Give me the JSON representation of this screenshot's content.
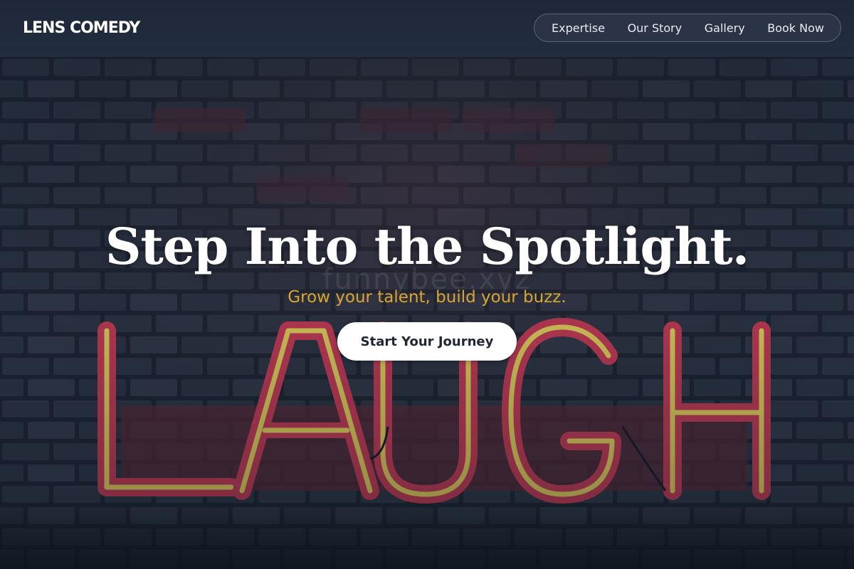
{
  "header": {
    "logo": "LENS COMEDY",
    "nav": [
      {
        "label": "Expertise"
      },
      {
        "label": "Our Story"
      },
      {
        "label": "Gallery"
      },
      {
        "label": "Book Now"
      }
    ]
  },
  "hero": {
    "title": "Step Into the Spotlight.",
    "subtitle": "Grow your talent, build your buzz.",
    "cta_label": "Start Your Journey",
    "background_image": {
      "neon_sign_text": "LAUGH",
      "watermark_text": "funnybee.xyz"
    }
  },
  "colors": {
    "header_bg": "#1f2a3b",
    "accent_gold": "#d9a532",
    "neon_red": "#d23a55",
    "neon_yellow": "#e3d35a",
    "button_bg": "#ffffff",
    "button_text": "#1f2735"
  }
}
